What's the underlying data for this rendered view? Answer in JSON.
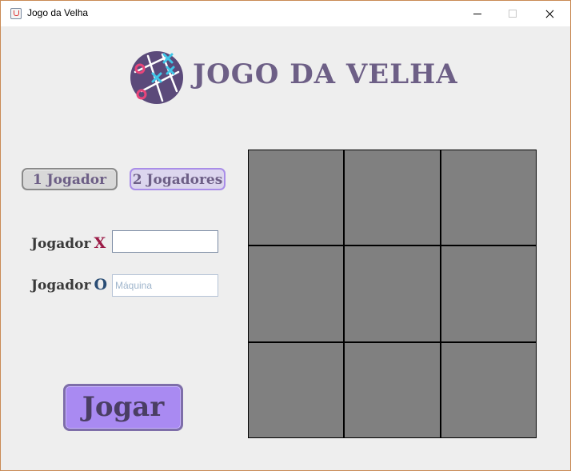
{
  "window": {
    "title": "Jogo da Velha"
  },
  "app": {
    "heading": "JOGO DA VELHA"
  },
  "modes": {
    "one_player": "1 Jogador",
    "two_players": "2 Jogadores",
    "selected": "2 Jogadores"
  },
  "players": {
    "x": {
      "label": "Jogador",
      "symbol": "X",
      "value": ""
    },
    "o": {
      "label": "Jogador",
      "symbol": "O",
      "value": "",
      "placeholder": "Máquina"
    }
  },
  "play_button": "Jogar",
  "board": {
    "cells": [
      "",
      "",
      "",
      "",
      "",
      "",
      "",
      "",
      ""
    ]
  },
  "colors": {
    "accent": "#a98af2",
    "cell": "#808080",
    "symbol_x": "#9b1b46",
    "symbol_o": "#2a4d75"
  }
}
